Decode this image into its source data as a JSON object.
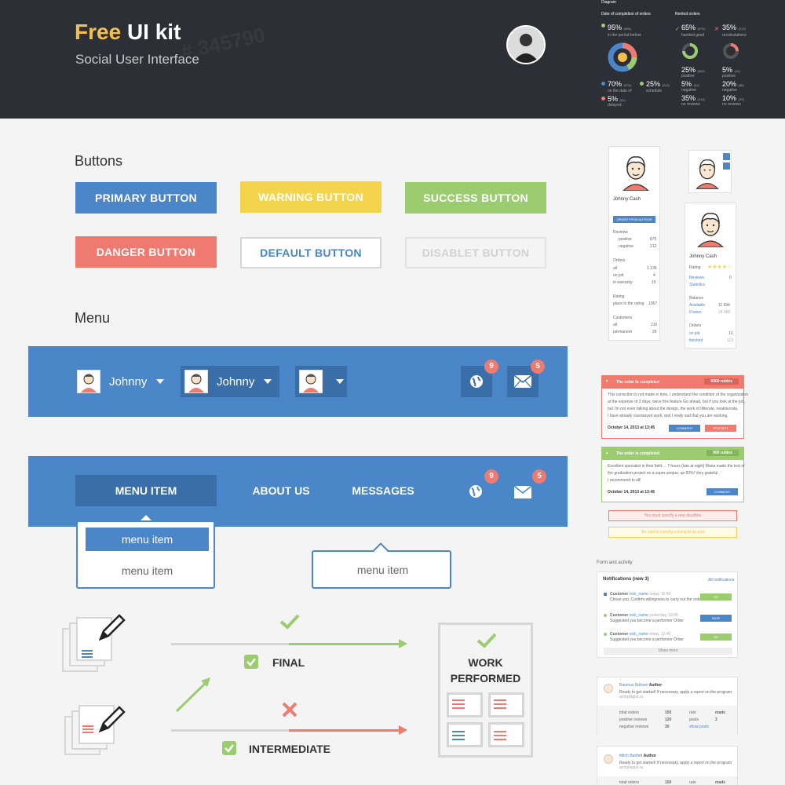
{
  "header": {
    "brand_free": "Free",
    "brand_rest": "UI kit",
    "subtitle": "Social User Interface",
    "bg_number": "# 345790"
  },
  "diagram": {
    "title": "Diagram",
    "col1_title": "Date of completion of orders",
    "col2_title": "Rented orders",
    "s95": "95%",
    "s95_sub": "(836)",
    "s95_cap": "in the period before",
    "s70": "70%",
    "s70_sub": "(675)",
    "s70_cap": "on the date of",
    "s25": "25%",
    "s25_sub": "(212)",
    "s25_cap": "schedule",
    "s5": "5%",
    "s5_sub": "(51)",
    "s5_cap": "delayed",
    "r65": "65%",
    "r65_sub": "(675)",
    "r65_cap": "handed good",
    "r35": "35%",
    "r35_sub": "(212)",
    "r35_cap": "recalculations",
    "r25": "25%",
    "r25_sub": "(642)",
    "r25_cap": "positive",
    "r5a": "5%",
    "r5a_sub": "(12)",
    "r5a_cap": "positive",
    "r5b": "5%",
    "r5b_sub": "(31)",
    "r5b_cap": "negative",
    "r20": "20%",
    "r20_sub": "(86)",
    "r20_cap": "negative",
    "r35b": "35%",
    "r35b_sub": "(214)",
    "r35b_cap": "no reviews",
    "r10": "10%",
    "r10_sub": "(23)",
    "r10_cap": "no reviews"
  },
  "buttons_section": {
    "title": "Buttons",
    "primary": "PRIMARY BUTTON",
    "warning": "WARNING BUTTON",
    "success": "SUCCESS BUTTON",
    "danger": "DANGER BUTTON",
    "default": "DEFAULT BUTTON",
    "disabled": "DISABLET BUTTON"
  },
  "menu_section": {
    "title": "Menu",
    "user1": "Johnny",
    "user2": "Johnny",
    "globe_badge": "9",
    "mail_badge": "5",
    "nav": [
      "MENU ITEM",
      "ABOUT US",
      "MESSAGES"
    ],
    "globe_badge2": "9",
    "mail_badge2": "5",
    "dropdown": [
      "menu item",
      "menu item"
    ],
    "tooltip_item": "menu item"
  },
  "flow": {
    "final": "FINAL",
    "intermediate": "INTERMEDIATE",
    "work1": "WORK",
    "work2": "PERFORMED"
  },
  "profile1": {
    "name": "Johnny Cash",
    "btn": "ORDER FROM AUTHOR",
    "reviews": "Reviews",
    "positive": "positive",
    "positive_v": "875",
    "negative": "negative",
    "negative_v": "212",
    "orders": "Orders",
    "all": "all",
    "all_v": "1 136",
    "onjob": "on job",
    "onjob_v": "4",
    "warranty": "in warranty",
    "warranty_v": "15",
    "rating": "Rating",
    "place": "place in the rating",
    "place_v": "1367",
    "customers": "Customers",
    "c_all": "all",
    "c_all_v": "210",
    "c_perm": "permanent",
    "c_perm_v": "26"
  },
  "profile2": {
    "name": "Johnny Cash",
    "rating": "Rating",
    "reviews": "Reviews",
    "reviews_v": "0",
    "statistics": "Statistics",
    "balance": "Balance",
    "available": "Available",
    "available_v": "11 694",
    "frozen": "Frozen",
    "frozen_v": "24 000",
    "orders": "Orders",
    "onjob": "on job",
    "onjob_v": "12",
    "finished": "finished",
    "finished_v": "123"
  },
  "notice1": {
    "title": "The order is completed",
    "amount": "6000 rubles",
    "text1": "This correction is not made in time, I understand the condition of the organization",
    "text2": "at the expense of 3 days, twice this feature Go ahead, but if you look at the job,",
    "text3": "but I'm not even talking about the design, the work of Illiterate, neaktiurrata,",
    "text4": "I have already overstayed work, and I really sad that you are working.",
    "date": "October 14, 2013 at 13:45",
    "btn1": "COMMENT",
    "btn2": "PROTEST"
  },
  "notice2": {
    "title": "The order is completed",
    "amount": "500 rubles",
    "text1": "Excellent specialist in their field ... 7 hours (late at night) Maria made the text of",
    "text2": "the graduation project on a super unique, up 83%! Very grateful.",
    "text3": "I recommend to all!",
    "date": "October 14, 2013 at 13:45",
    "btn1": "COMMENT"
  },
  "alerts": {
    "red": "You must specify a new deadline",
    "yellow": "Be careful coming coming to an end"
  },
  "form_activity": {
    "title": "Form and activity",
    "notif_title": "Notifications",
    "notif_count": "(new 3)",
    "all_link": "All notifications",
    "n1_user": "Customer",
    "n1_nick": "nick_name",
    "n1_time": "today, 12:40",
    "n1_text": "Chose you. Confirm willingness to carry out the order",
    "n1_btn": "OK",
    "n2_user": "Customer",
    "n2_nick": "nick_name",
    "n2_time": "yesterday, 19:55",
    "n2_text": "Suggested you become a performer Order",
    "n2_btn": "RATE",
    "n3_user": "Customer",
    "n3_nick": "nick_name",
    "n3_time": "today, 12:40",
    "n3_text": "Suggested you become a performer Order",
    "n3_btn": "OK",
    "show_more": "Show more"
  },
  "author1": {
    "name": "Rasmus Nielsen",
    "role": "Author",
    "text": "Ready to get started! If necessary, apply a report on the program",
    "link": "ambplagiat.ru",
    "total": "total orders",
    "total_v": "150",
    "pos": "positive reviews",
    "pos_v": "120",
    "neg": "negative reviews",
    "neg_v": "30",
    "rate": "rate",
    "rate_v": "made",
    "posts": "posts",
    "posts_v": "3",
    "show_posts": "show posts"
  },
  "author2": {
    "name": "Mitch Bartlett",
    "role": "Author",
    "text": "Ready to get started! If necessary, apply a report on the program",
    "link": "ambplagiat.ru",
    "total": "total orders",
    "total_v": "150",
    "rate": "rate",
    "rate_v": "made"
  },
  "colors": {
    "blue": "#4a86c8",
    "blue_dark": "#3a6ea9",
    "yellow": "#f5d44d",
    "green": "#9ccc70",
    "red": "#ef7a70",
    "header_bg": "#2c3036"
  }
}
